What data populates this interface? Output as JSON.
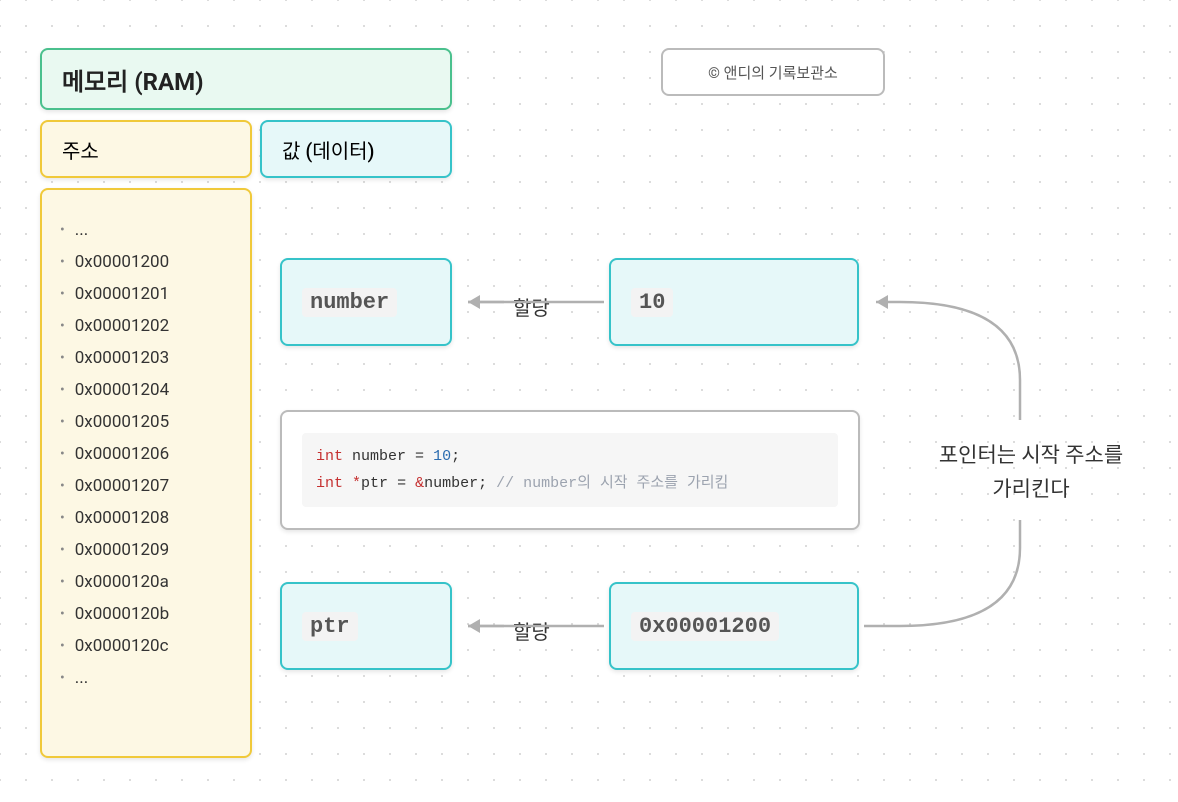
{
  "title": "메모리 (RAM)",
  "attribution": "© 앤디의 기록보관소",
  "headers": {
    "address": "주소",
    "value": "값 (데이터)"
  },
  "addresses": [
    "...",
    "0x00001200",
    "0x00001201",
    "0x00001202",
    "0x00001203",
    "0x00001204",
    "0x00001205",
    "0x00001206",
    "0x00001207",
    "0x00001208",
    "0x00001209",
    "0x0000120a",
    "0x0000120b",
    "0x0000120c",
    "..."
  ],
  "vars": {
    "number_name": "number",
    "number_value": "10",
    "ptr_name": "ptr",
    "ptr_value": "0x00001200"
  },
  "labels": {
    "assign": "할당",
    "pointer_note": "포인터는 시작 주소를\n가리킨다"
  },
  "code": {
    "kw_int": "int",
    "id_number": "number",
    "eq": " = ",
    "val_10": "10",
    "semi": ";",
    "star": "*",
    "id_ptr": "ptr",
    "amp": "&",
    "comment": " // number의 시작 주소를 가리킴"
  }
}
